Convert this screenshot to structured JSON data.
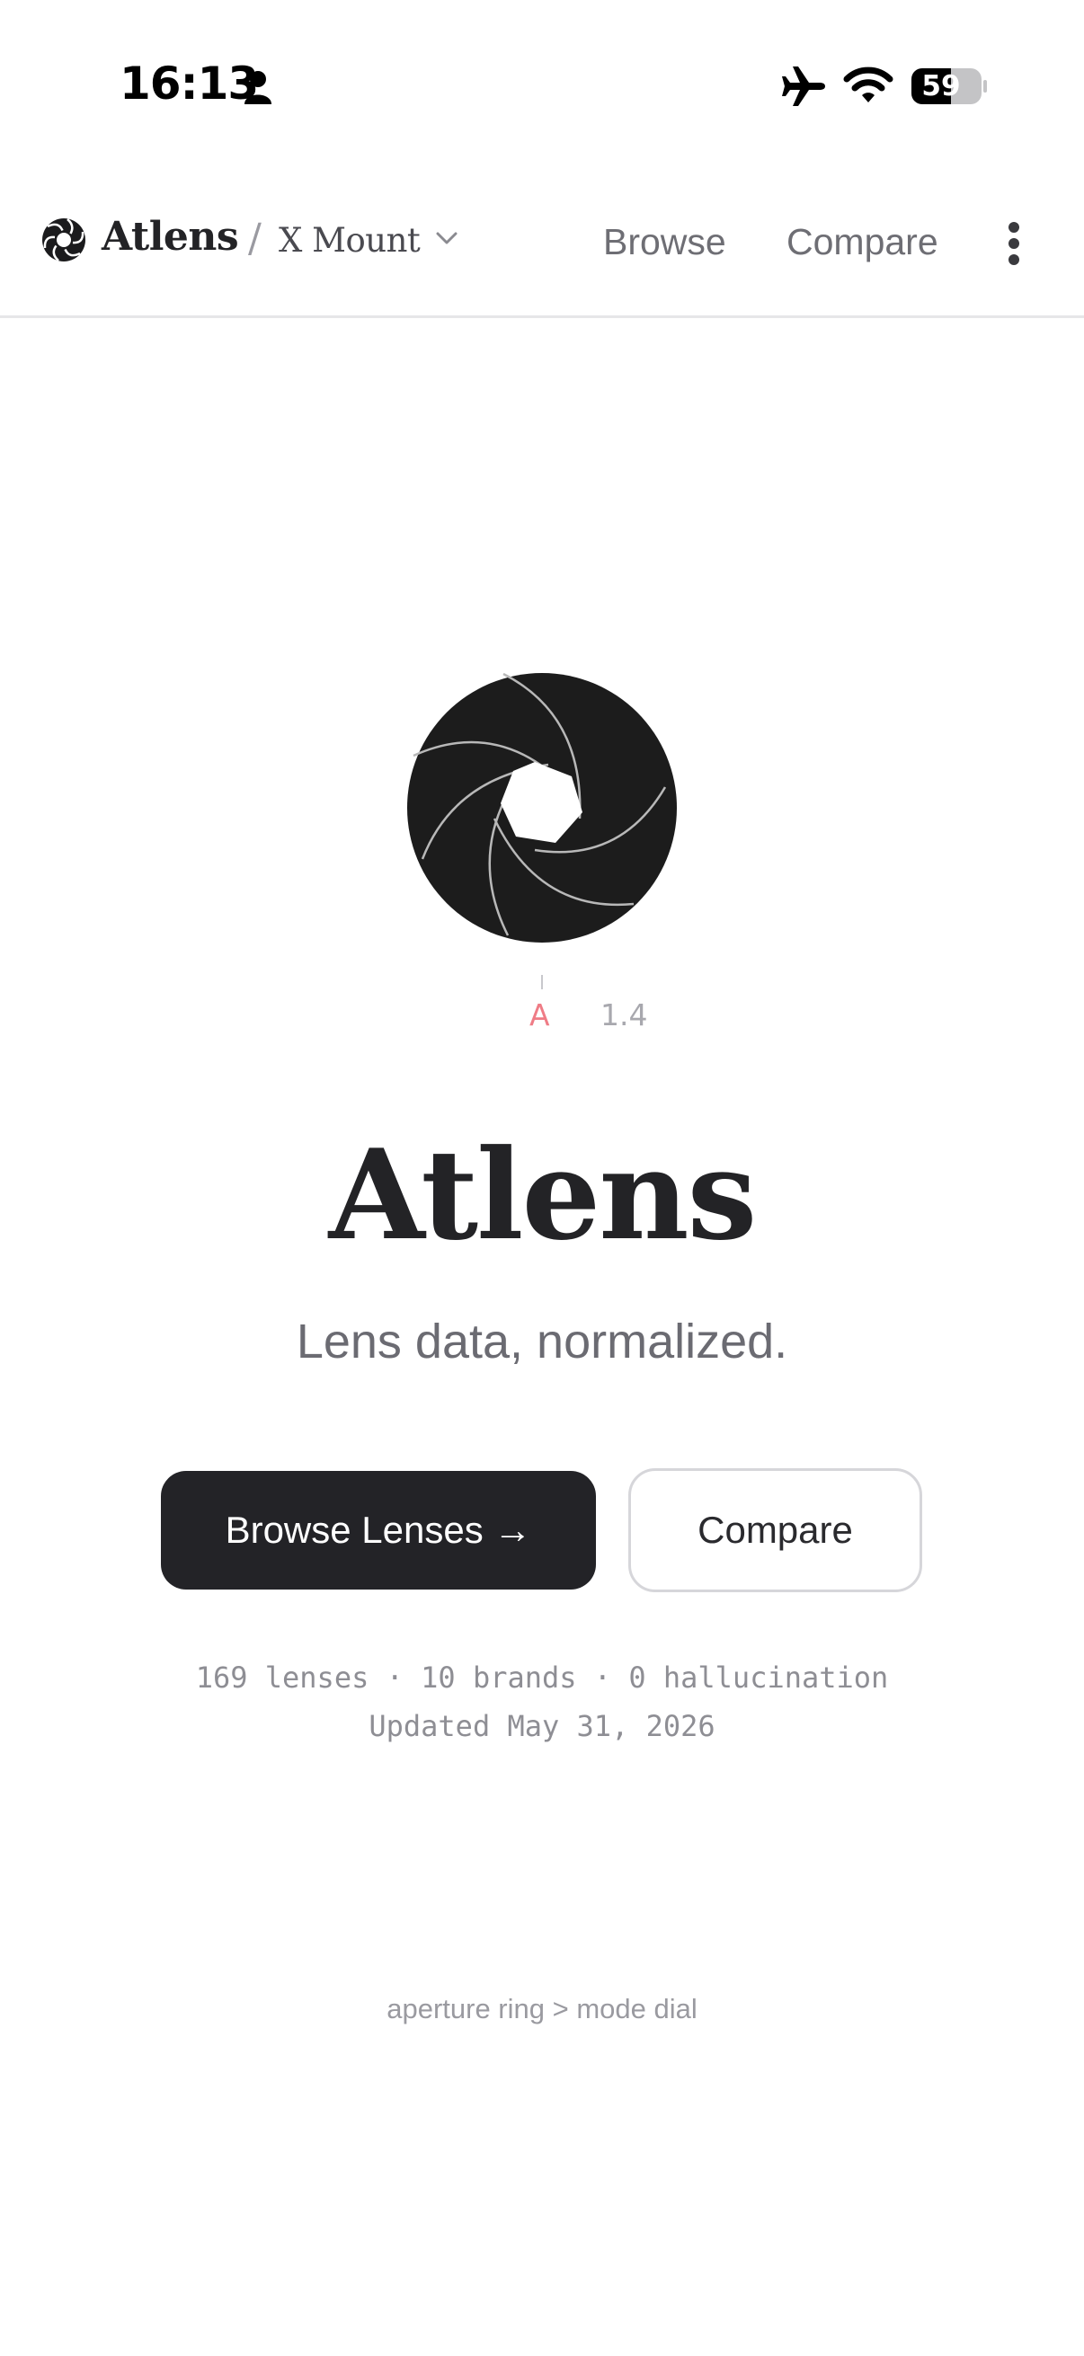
{
  "status_bar": {
    "time": "16:13",
    "battery_level": "59",
    "icons": [
      "person-icon",
      "airplane-icon",
      "wifi-icon",
      "battery-icon"
    ]
  },
  "navbar": {
    "brand": "Atlens",
    "separator": "/",
    "mount": "X Mount",
    "links": [
      "Browse",
      "Compare"
    ],
    "icons": [
      "aperture-logo-icon",
      "chevron-down-icon",
      "kebab-menu-icon"
    ]
  },
  "hero": {
    "dial_mode": "A",
    "dial_value": "1.4",
    "title": "Atlens",
    "tagline": "Lens data, normalized.",
    "primary_button": "Browse Lenses →",
    "secondary_button": "Compare"
  },
  "stats": {
    "line1": "169 lenses · 10 brands · 0 hallucination",
    "line2": "Updated May 31, 2026"
  },
  "footer": {
    "note": "aperture ring > mode dial"
  },
  "colors": {
    "ink": "#232326",
    "accent_red": "#ef7c86",
    "muted": "#6b6b72"
  }
}
